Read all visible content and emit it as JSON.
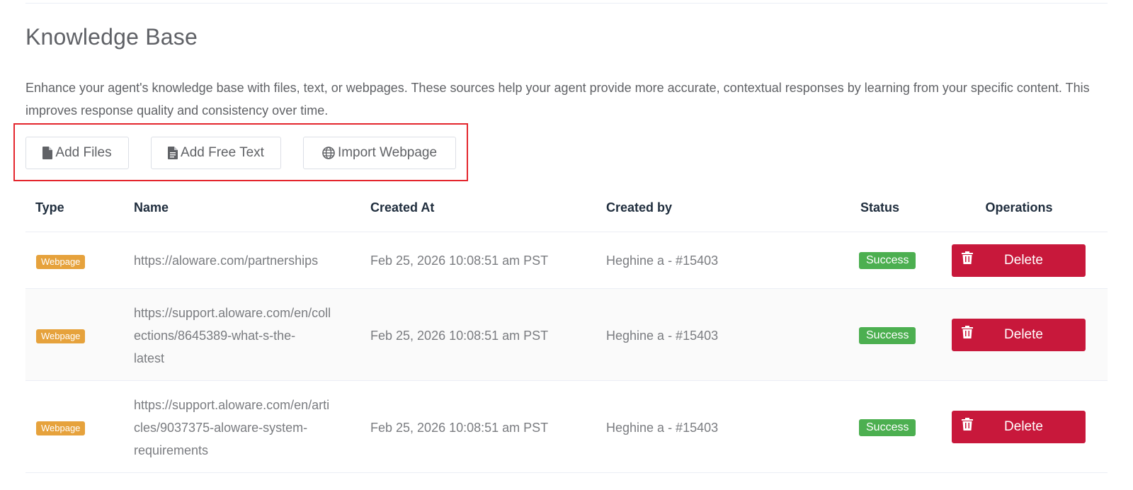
{
  "page": {
    "title": "Knowledge Base",
    "description": "Enhance your agent's knowledge base with files, text, or webpages. These sources help your agent provide more accurate, contextual responses by learning from your specific content. This improves response quality and consistency over time."
  },
  "toolbar": {
    "add_files_label": "Add Files",
    "add_free_text_label": "Add Free Text",
    "import_webpage_label": "Import Webpage"
  },
  "table": {
    "headers": {
      "type": "Type",
      "name": "Name",
      "created_at": "Created At",
      "created_by": "Created by",
      "status": "Status",
      "operations": "Operations"
    },
    "rows": [
      {
        "type": "Webpage",
        "name_lines": [
          "https://aloware.com/partnerships"
        ],
        "created_at": "Feb 25, 2026 10:08:51 am PST",
        "created_by": "Heghine a - #15403",
        "status": "Success",
        "delete_label": "Delete"
      },
      {
        "type": "Webpage",
        "name_lines": [
          "https://support.aloware.com/en/coll",
          "ections/8645389-what-s-the-",
          "latest"
        ],
        "created_at": "Feb 25, 2026 10:08:51 am PST",
        "created_by": "Heghine a - #15403",
        "status": "Success",
        "delete_label": "Delete"
      },
      {
        "type": "Webpage",
        "name_lines": [
          "https://support.aloware.com/en/arti",
          "cles/9037375-aloware-system-",
          "requirements"
        ],
        "created_at": "Feb 25, 2026 10:08:51 am PST",
        "created_by": "Heghine a - #15403",
        "status": "Success",
        "delete_label": "Delete"
      }
    ]
  },
  "colors": {
    "tag_warning": "#e6a23c",
    "status_success": "#4caf50",
    "danger": "#c8183b",
    "highlight_border": "#e4262d"
  },
  "icons": {
    "add_files": "file-icon",
    "add_free_text": "document-icon",
    "import_webpage": "globe-icon",
    "delete": "trash-icon"
  }
}
